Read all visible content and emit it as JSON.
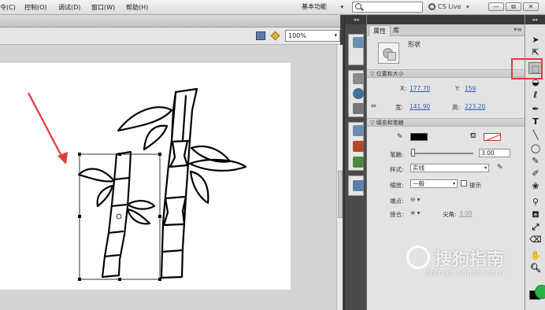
{
  "menubar": {
    "items": [
      "令(C)",
      "控制(O)",
      "调试(D)",
      "窗口(W)",
      "帮助(H)"
    ],
    "workspace_label": "基本功能",
    "cs_live_label": "CS Live",
    "window_buttons": [
      "—",
      "⧉",
      "✕"
    ]
  },
  "edit_bar": {
    "zoom_value": "100%"
  },
  "properties": {
    "tabs": [
      "属性",
      "库"
    ],
    "object_type": "形状",
    "position_size": {
      "header": "位置和大小",
      "x_label": "X:",
      "x_value": "177.70",
      "y_label": "Y:",
      "y_value": "159",
      "width_label": "宽:",
      "width_value": "141.90",
      "height_label": "高:",
      "height_value": "223.20"
    },
    "fill_stroke": {
      "header": "填充和笔触",
      "stroke_width_label": "笔触:",
      "stroke_width_value": "3.00",
      "style_label": "样式:",
      "style_value": "实线",
      "scale_label": "缩放:",
      "scale_value": "一般",
      "hint_label": "提示",
      "cap_label": "端点:",
      "join_label": "接合:",
      "miter_label": "尖角:",
      "miter_value": "3.00"
    }
  },
  "watermark": {
    "brand": "搜狗指南",
    "url": "zhinan.sogou.com"
  },
  "colors": {
    "annotation_red": "#e53a3a",
    "link_blue": "#2a5ab8",
    "dock_dark": "#4a4a4a"
  }
}
